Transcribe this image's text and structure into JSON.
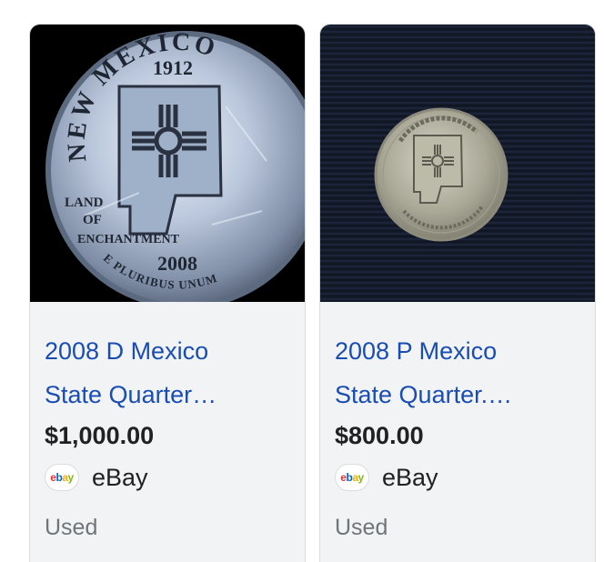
{
  "results": [
    {
      "title_line1": "2008 D Mexico",
      "title_line2": "State Quarter…",
      "price": "$1,000.00",
      "seller": "eBay",
      "condition": "Used",
      "coin_text": {
        "top": "NEW MEXICO",
        "year": "1912",
        "left_line1": "LAND",
        "left_line2": "OF",
        "left_line3": "ENCHANTMENT",
        "bottom_year": "2008",
        "motto": "E PLURIBUS UNUM"
      }
    },
    {
      "title_line1": "2008 P Mexico",
      "title_line2": "State Quarter.…",
      "price": "$800.00",
      "seller": "eBay",
      "condition": "Used"
    }
  ],
  "ebay_logo": {
    "letters": [
      "e",
      "b",
      "a",
      "y"
    ],
    "colors": [
      "#e53238",
      "#0064d2",
      "#f5af02",
      "#86b817"
    ]
  },
  "colors": {
    "title_link": "#1a4db3",
    "info_background": "#f1f3f4",
    "condition_text": "#70757a"
  }
}
